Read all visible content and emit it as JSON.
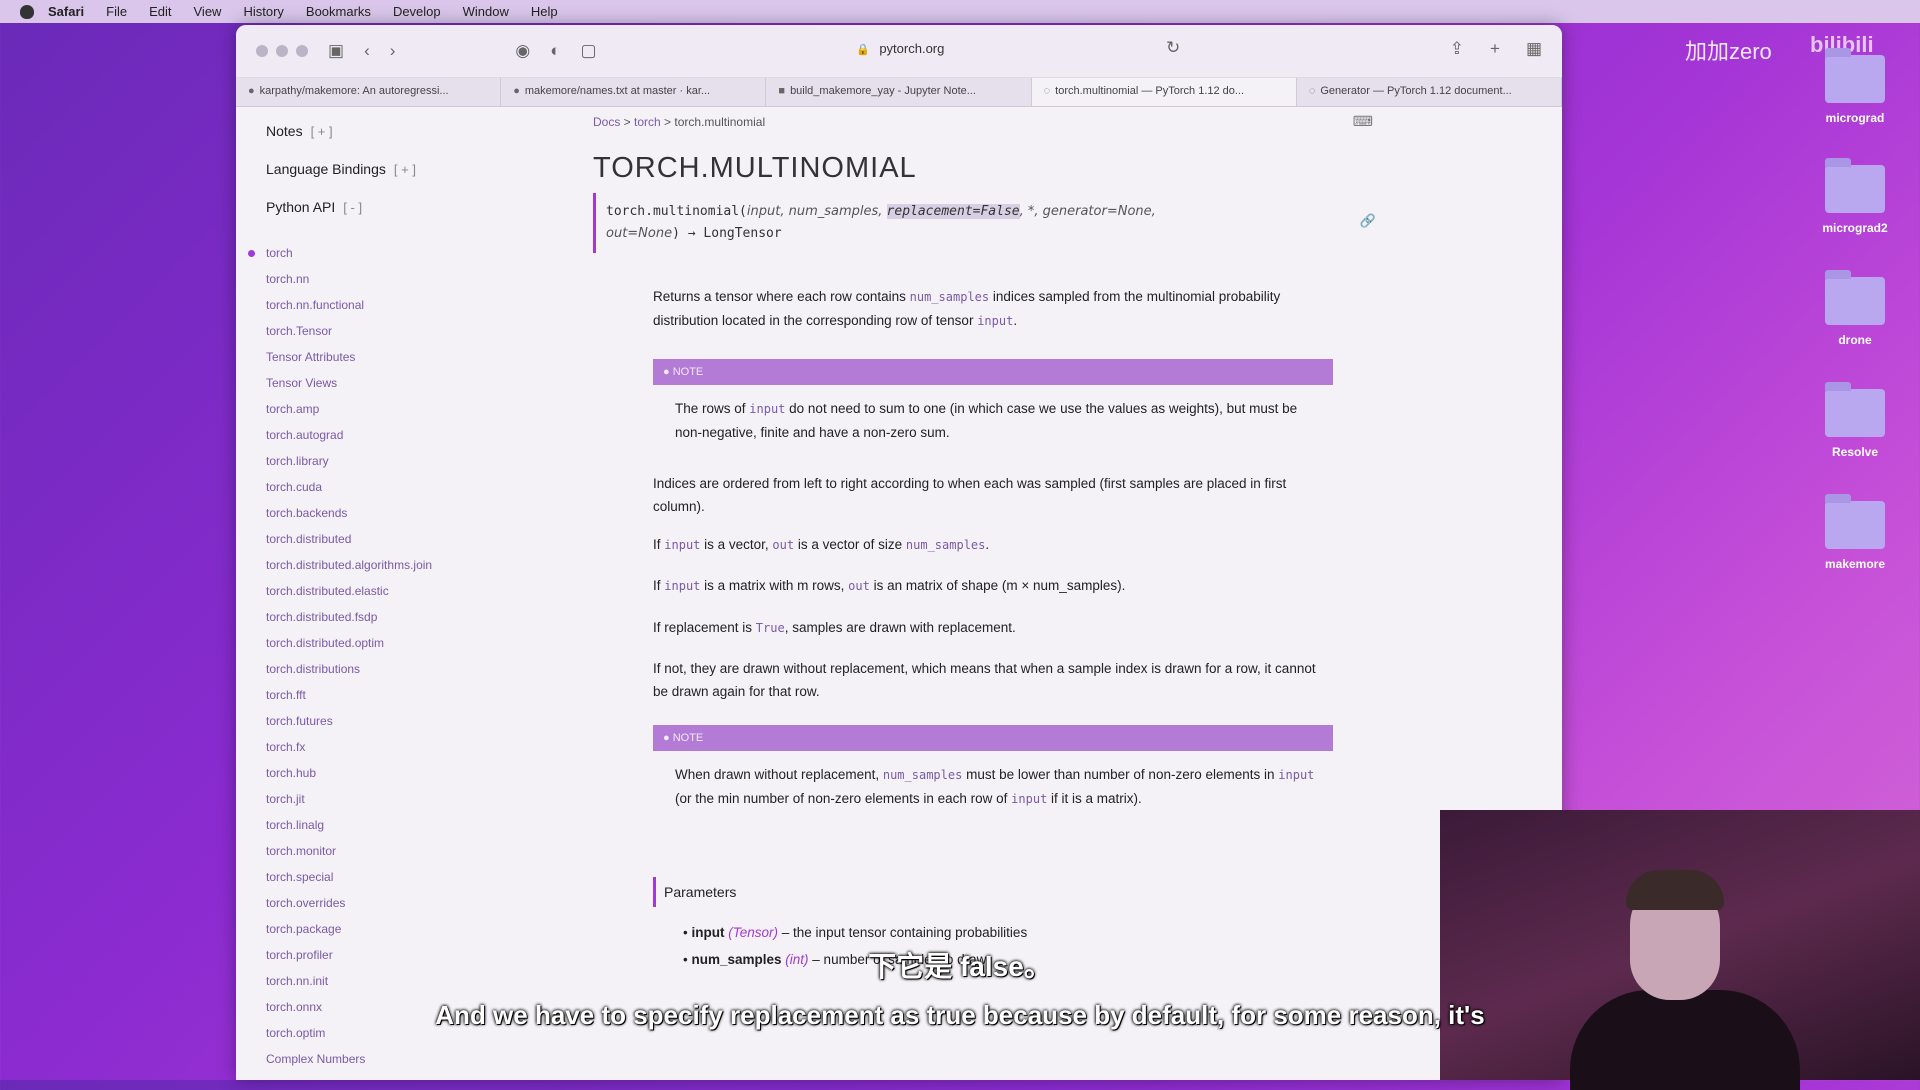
{
  "menubar": {
    "app": "Safari",
    "items": [
      "File",
      "Edit",
      "View",
      "History",
      "Bookmarks",
      "Develop",
      "Window",
      "Help"
    ]
  },
  "browser": {
    "address": "pytorch.org",
    "tabs": [
      {
        "icon": "github-icon",
        "label": "karpathy/makemore: An autoregressi..."
      },
      {
        "icon": "github-icon",
        "label": "makemore/names.txt at master · kar..."
      },
      {
        "icon": "jupyter-icon",
        "label": "build_makemore_yay - Jupyter Note..."
      },
      {
        "icon": "loading-icon",
        "label": "torch.multinomial — PyTorch 1.12 do..."
      },
      {
        "icon": "loading-icon",
        "label": "Generator — PyTorch 1.12 document..."
      }
    ]
  },
  "sidebar": {
    "notes": "Notes",
    "notes_toggle": "[ + ]",
    "bindings": "Language Bindings",
    "bindings_toggle": "[ + ]",
    "python_api": "Python API",
    "python_api_toggle": "[ - ]",
    "items": [
      "torch",
      "torch.nn",
      "torch.nn.functional",
      "torch.Tensor",
      "Tensor Attributes",
      "Tensor Views",
      "torch.amp",
      "torch.autograd",
      "torch.library",
      "torch.cuda",
      "torch.backends",
      "torch.distributed",
      "torch.distributed.algorithms.join",
      "torch.distributed.elastic",
      "torch.distributed.fsdp",
      "torch.distributed.optim",
      "torch.distributions",
      "torch.fft",
      "torch.futures",
      "torch.fx",
      "torch.hub",
      "torch.jit",
      "torch.linalg",
      "torch.monitor",
      "torch.special",
      "torch.overrides",
      "torch.package",
      "torch.profiler",
      "torch.nn.init",
      "torch.onnx",
      "torch.optim",
      "Complex Numbers"
    ]
  },
  "doc": {
    "breadcrumb": [
      "Docs",
      "torch",
      "torch.multinomial"
    ],
    "title": "TORCH.MULTINOMIAL",
    "sig_fn": "torch.multinomial(",
    "sig_p1": "input, num_samples, ",
    "sig_hl": "replacement=False",
    "sig_p2": ", *, generator=None,",
    "sig_p3": "out=None",
    "sig_ret": ") → LongTensor",
    "p1a": "Returns a tensor where each row contains ",
    "p1_code": "num_samples",
    "p1b": " indices sampled from the multinomial probability distribution located in the corresponding row of tensor ",
    "p1_code2": "input",
    "p1c": ".",
    "note_label": "NOTE",
    "note1a": "The rows of ",
    "note1_code": "input",
    "note1b": " do not need to sum to one (in which case we use the values as weights), but must be non-negative, finite and have a non-zero sum.",
    "p2": "Indices are ordered from left to right according to when each was sampled (first samples are placed in first column).",
    "p3a": "If ",
    "p3_code1": "input",
    "p3b": " is a vector, ",
    "p3_code2": "out",
    "p3c": " is a vector of size ",
    "p3_code3": "num_samples",
    "p3d": ".",
    "p4a": "If ",
    "p4_code1": "input",
    "p4b": " is a matrix with m rows, ",
    "p4_code2": "out",
    "p4c": " is an matrix of shape (m × num_samples).",
    "p5a": "If replacement is ",
    "p5_code": "True",
    "p5b": ", samples are drawn with replacement.",
    "p6": "If not, they are drawn without replacement, which means that when a sample index is drawn for a row, it cannot be drawn again for that row.",
    "note2a": "When drawn without replacement, ",
    "note2_code": "num_samples",
    "note2b": " must be lower than number of non-zero elements in ",
    "note2_code2": "input",
    "note2c": " (or the min number of non-zero elements in each row of ",
    "note2_code3": "input",
    "note2d": " if it is a matrix).",
    "params_title": "Parameters",
    "param1_name": "input",
    "param1_type": "(Tensor)",
    "param1_desc": " – the input tensor containing probabilities",
    "param2_name": "num_samples",
    "param2_type": "(int)",
    "param2_desc": " – number of samples to draw"
  },
  "desktop": [
    {
      "label": "micrograd"
    },
    {
      "label": "micrograd2"
    },
    {
      "label": "drone"
    },
    {
      "label": "Resolve"
    },
    {
      "label": "makemore"
    }
  ],
  "overlay": {
    "watermark": "加加zero",
    "bili": "bilibili",
    "subtitle_cn": "下它是 false。",
    "subtitle_en": "And we have to specify replacement as true because by default, for some reason, it's"
  }
}
